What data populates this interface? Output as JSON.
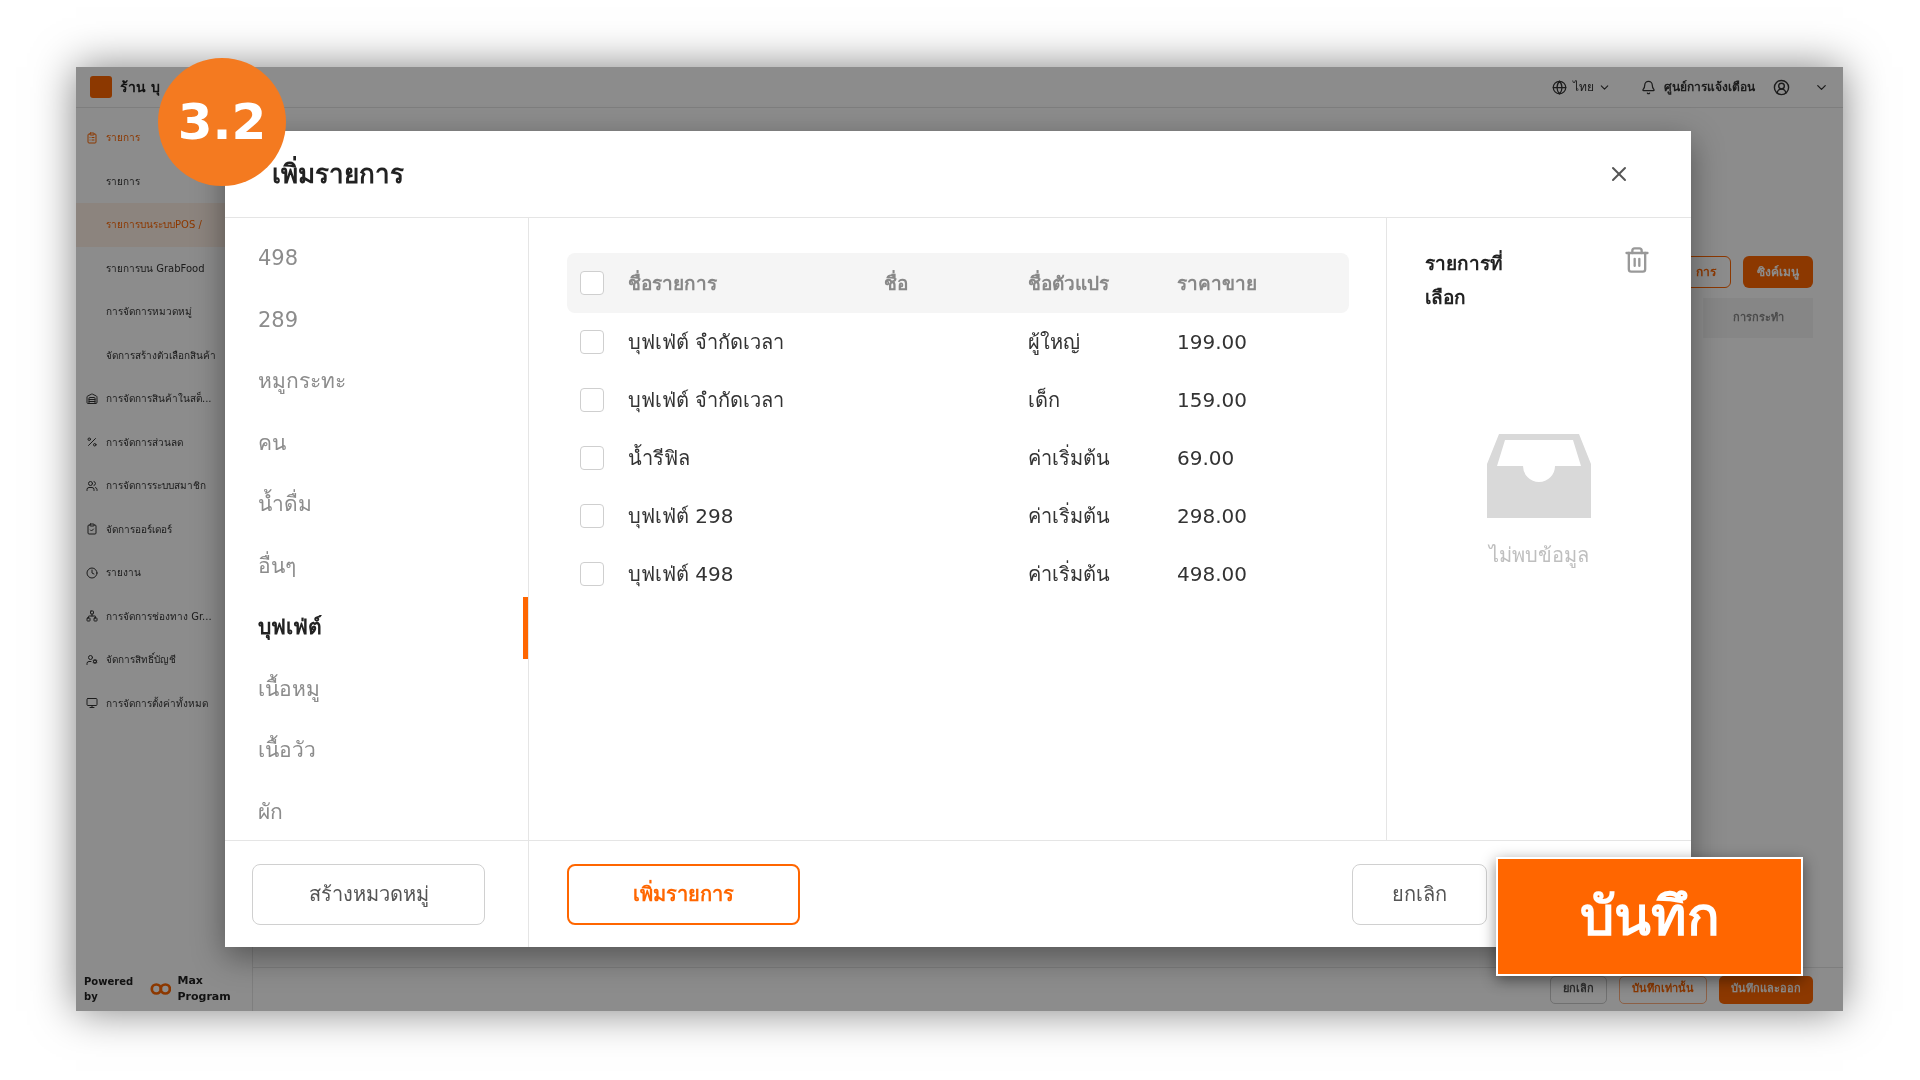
{
  "app": {
    "shop_name": "ร้าน บุ",
    "language": "ไทย",
    "notifications": "ศูนย์การแจ้งเตือน",
    "sidebar": [
      {
        "label": "รายการ",
        "kind": "section",
        "selected": true
      },
      {
        "label": "รายการ",
        "kind": "sub",
        "selected": false
      },
      {
        "label": "รายการบนระบบPOS /",
        "kind": "sub",
        "selected": true
      },
      {
        "label": "รายการบน GrabFood",
        "kind": "sub",
        "selected": false
      },
      {
        "label": "การจัดการหมวดหมู่",
        "kind": "sub",
        "selected": false
      },
      {
        "label": "จัดการสร้างตัวเลือกสินค้า",
        "kind": "sub",
        "selected": false
      },
      {
        "label": "การจัดการสินค้าในสต็...",
        "kind": "section",
        "selected": false
      },
      {
        "label": "การจัดการส่วนลด",
        "kind": "section",
        "selected": false
      },
      {
        "label": "การจัดการระบบสมาชิก",
        "kind": "section",
        "selected": false
      },
      {
        "label": "จัดการออร์เดอร์",
        "kind": "section",
        "selected": false
      },
      {
        "label": "รายงาน",
        "kind": "section",
        "selected": false
      },
      {
        "label": "การจัดการช่องทาง Gr...",
        "kind": "section",
        "selected": false
      },
      {
        "label": "จัดการสิทธิ์บัญชี",
        "kind": "section",
        "selected": false
      },
      {
        "label": "การจัดการตั้งค่าทั้งหมด",
        "kind": "section",
        "selected": false
      }
    ],
    "powered_by": "Powered by",
    "brand": "Max Program"
  },
  "page": {
    "buttons": [
      {
        "label": "การ",
        "kind": "outline"
      },
      {
        "label": "ซิงค์เมนู",
        "kind": "filled"
      }
    ],
    "column": "การกระทำ",
    "footer_buttons": [
      {
        "label": "ยกเลิก",
        "kind": "plain"
      },
      {
        "label": "บันทึกเท่านั้น",
        "kind": "outline"
      },
      {
        "label": "บันทึกและออก",
        "kind": "filled"
      }
    ]
  },
  "modal": {
    "title": "เพิ่มรายการ",
    "categories": [
      {
        "label": "498",
        "selected": false
      },
      {
        "label": "289",
        "selected": false
      },
      {
        "label": "หมูกระทะ",
        "selected": false
      },
      {
        "label": "คน",
        "selected": false
      },
      {
        "label": "น้ำดื่ม",
        "selected": false
      },
      {
        "label": "อื่นๆ",
        "selected": false
      },
      {
        "label": "บุฟเฟ่ต์",
        "selected": true
      },
      {
        "label": "เนื้อหมู",
        "selected": false
      },
      {
        "label": "เนื้อวัว",
        "selected": false
      },
      {
        "label": "ผัก",
        "selected": false
      }
    ],
    "table": {
      "all_checked": false,
      "columns": [
        "ชื่อรายการ",
        "ชื่อ",
        "ชื่อตัวแปร",
        "ราคาขาย"
      ],
      "rows": [
        {
          "checked": false,
          "cells": [
            "บุฟเฟ่ต์ จำกัดเวลา",
            "",
            "ผู้ใหญ่",
            "199.00"
          ]
        },
        {
          "checked": false,
          "cells": [
            "บุฟเฟ่ต์ จำกัดเวลา",
            "",
            "เด็ก",
            "159.00"
          ]
        },
        {
          "checked": false,
          "cells": [
            "น้ำรีฟิล",
            "",
            "ค่าเริ่มต้น",
            "69.00"
          ]
        },
        {
          "checked": false,
          "cells": [
            "บุฟเฟ่ต์ 298",
            "",
            "ค่าเริ่มต้น",
            "298.00"
          ]
        },
        {
          "checked": false,
          "cells": [
            "บุฟเฟ่ต์ 498",
            "",
            "ค่าเริ่มต้น",
            "498.00"
          ]
        }
      ]
    },
    "selected_title": "รายการที่เลือก",
    "empty_text": "ไม่พบข้อมูล",
    "create_category": "สร้างหมวดหมู่",
    "add_item": "เพิ่มรายการ",
    "cancel": "ยกเลิก"
  },
  "badge": "3.2",
  "callout": "บันทึก"
}
